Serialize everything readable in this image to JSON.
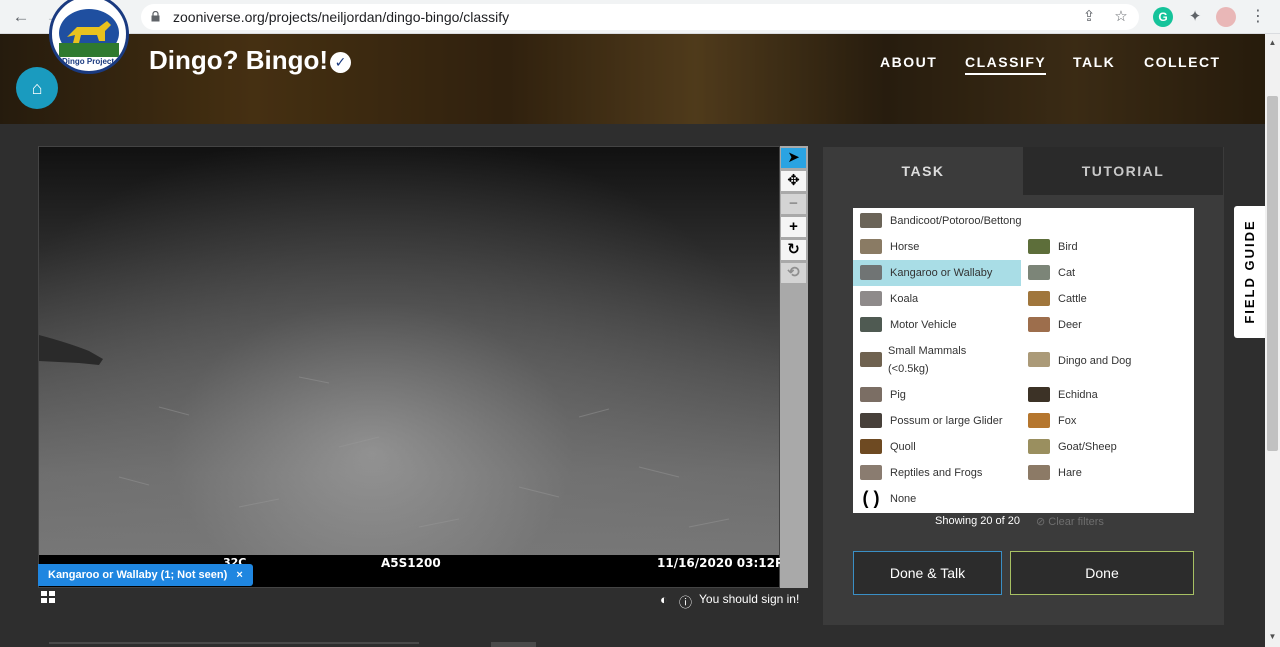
{
  "browser": {
    "url": "zooniverse.org/projects/neiljordan/dingo-bingo/classify"
  },
  "header": {
    "title": "Dingo? Bingo!",
    "logo_text": "Dingo Project",
    "nav": [
      {
        "label": "ABOUT"
      },
      {
        "label": "CLASSIFY"
      },
      {
        "label": "TALK"
      },
      {
        "label": "COLLECT"
      }
    ]
  },
  "viewer": {
    "strip_left": "32C",
    "strip_center": "A5S1200",
    "strip_right": "11/16/2020 03:12PM",
    "annotation_label": "Kangaroo or Wallaby (1; Not seen)",
    "annotation_close": "×",
    "signin_text": "You should sign in!"
  },
  "task_panel": {
    "tabs": [
      {
        "label": "TASK"
      },
      {
        "label": "TUTORIAL"
      }
    ],
    "choices": [
      {
        "label": "Bandicoot/Potoroo/Bettong",
        "color": "#6b6458"
      },
      {
        "label": "Horse",
        "color": "#8a7b64"
      },
      {
        "label": "Bird",
        "color": "#5d6e3a"
      },
      {
        "label": "Kangaroo or Wallaby",
        "color": "#707474",
        "selected": true
      },
      {
        "label": "Cat",
        "color": "#7c8578"
      },
      {
        "label": "Koala",
        "color": "#8e8a8a"
      },
      {
        "label": "Cattle",
        "color": "#a0763c"
      },
      {
        "label": "Motor Vehicle",
        "color": "#4f5a52"
      },
      {
        "label": "Deer",
        "color": "#9d6e4c"
      },
      {
        "label": "Small Mammals (<0.5kg)",
        "color": "#6f6250"
      },
      {
        "label": "Dingo and Dog",
        "color": "#ab9a78"
      },
      {
        "label": "Pig",
        "color": "#7b6e64"
      },
      {
        "label": "Echidna",
        "color": "#3c3226"
      },
      {
        "label": "Possum or large Glider",
        "color": "#47403a"
      },
      {
        "label": "Fox",
        "color": "#b5762e"
      },
      {
        "label": "Quoll",
        "color": "#6e4a22"
      },
      {
        "label": "Goat/Sheep",
        "color": "#9a8f5f"
      },
      {
        "label": "Reptiles and Frogs",
        "color": "#8a7c70"
      },
      {
        "label": "Hare",
        "color": "#8c7a66"
      },
      {
        "label": "None",
        "color": "#000000"
      }
    ],
    "showing": "Showing 20 of 20",
    "clear_filters": "Clear filters",
    "done_talk": "Done & Talk",
    "done": "Done"
  },
  "field_guide": "FIELD GUIDE"
}
